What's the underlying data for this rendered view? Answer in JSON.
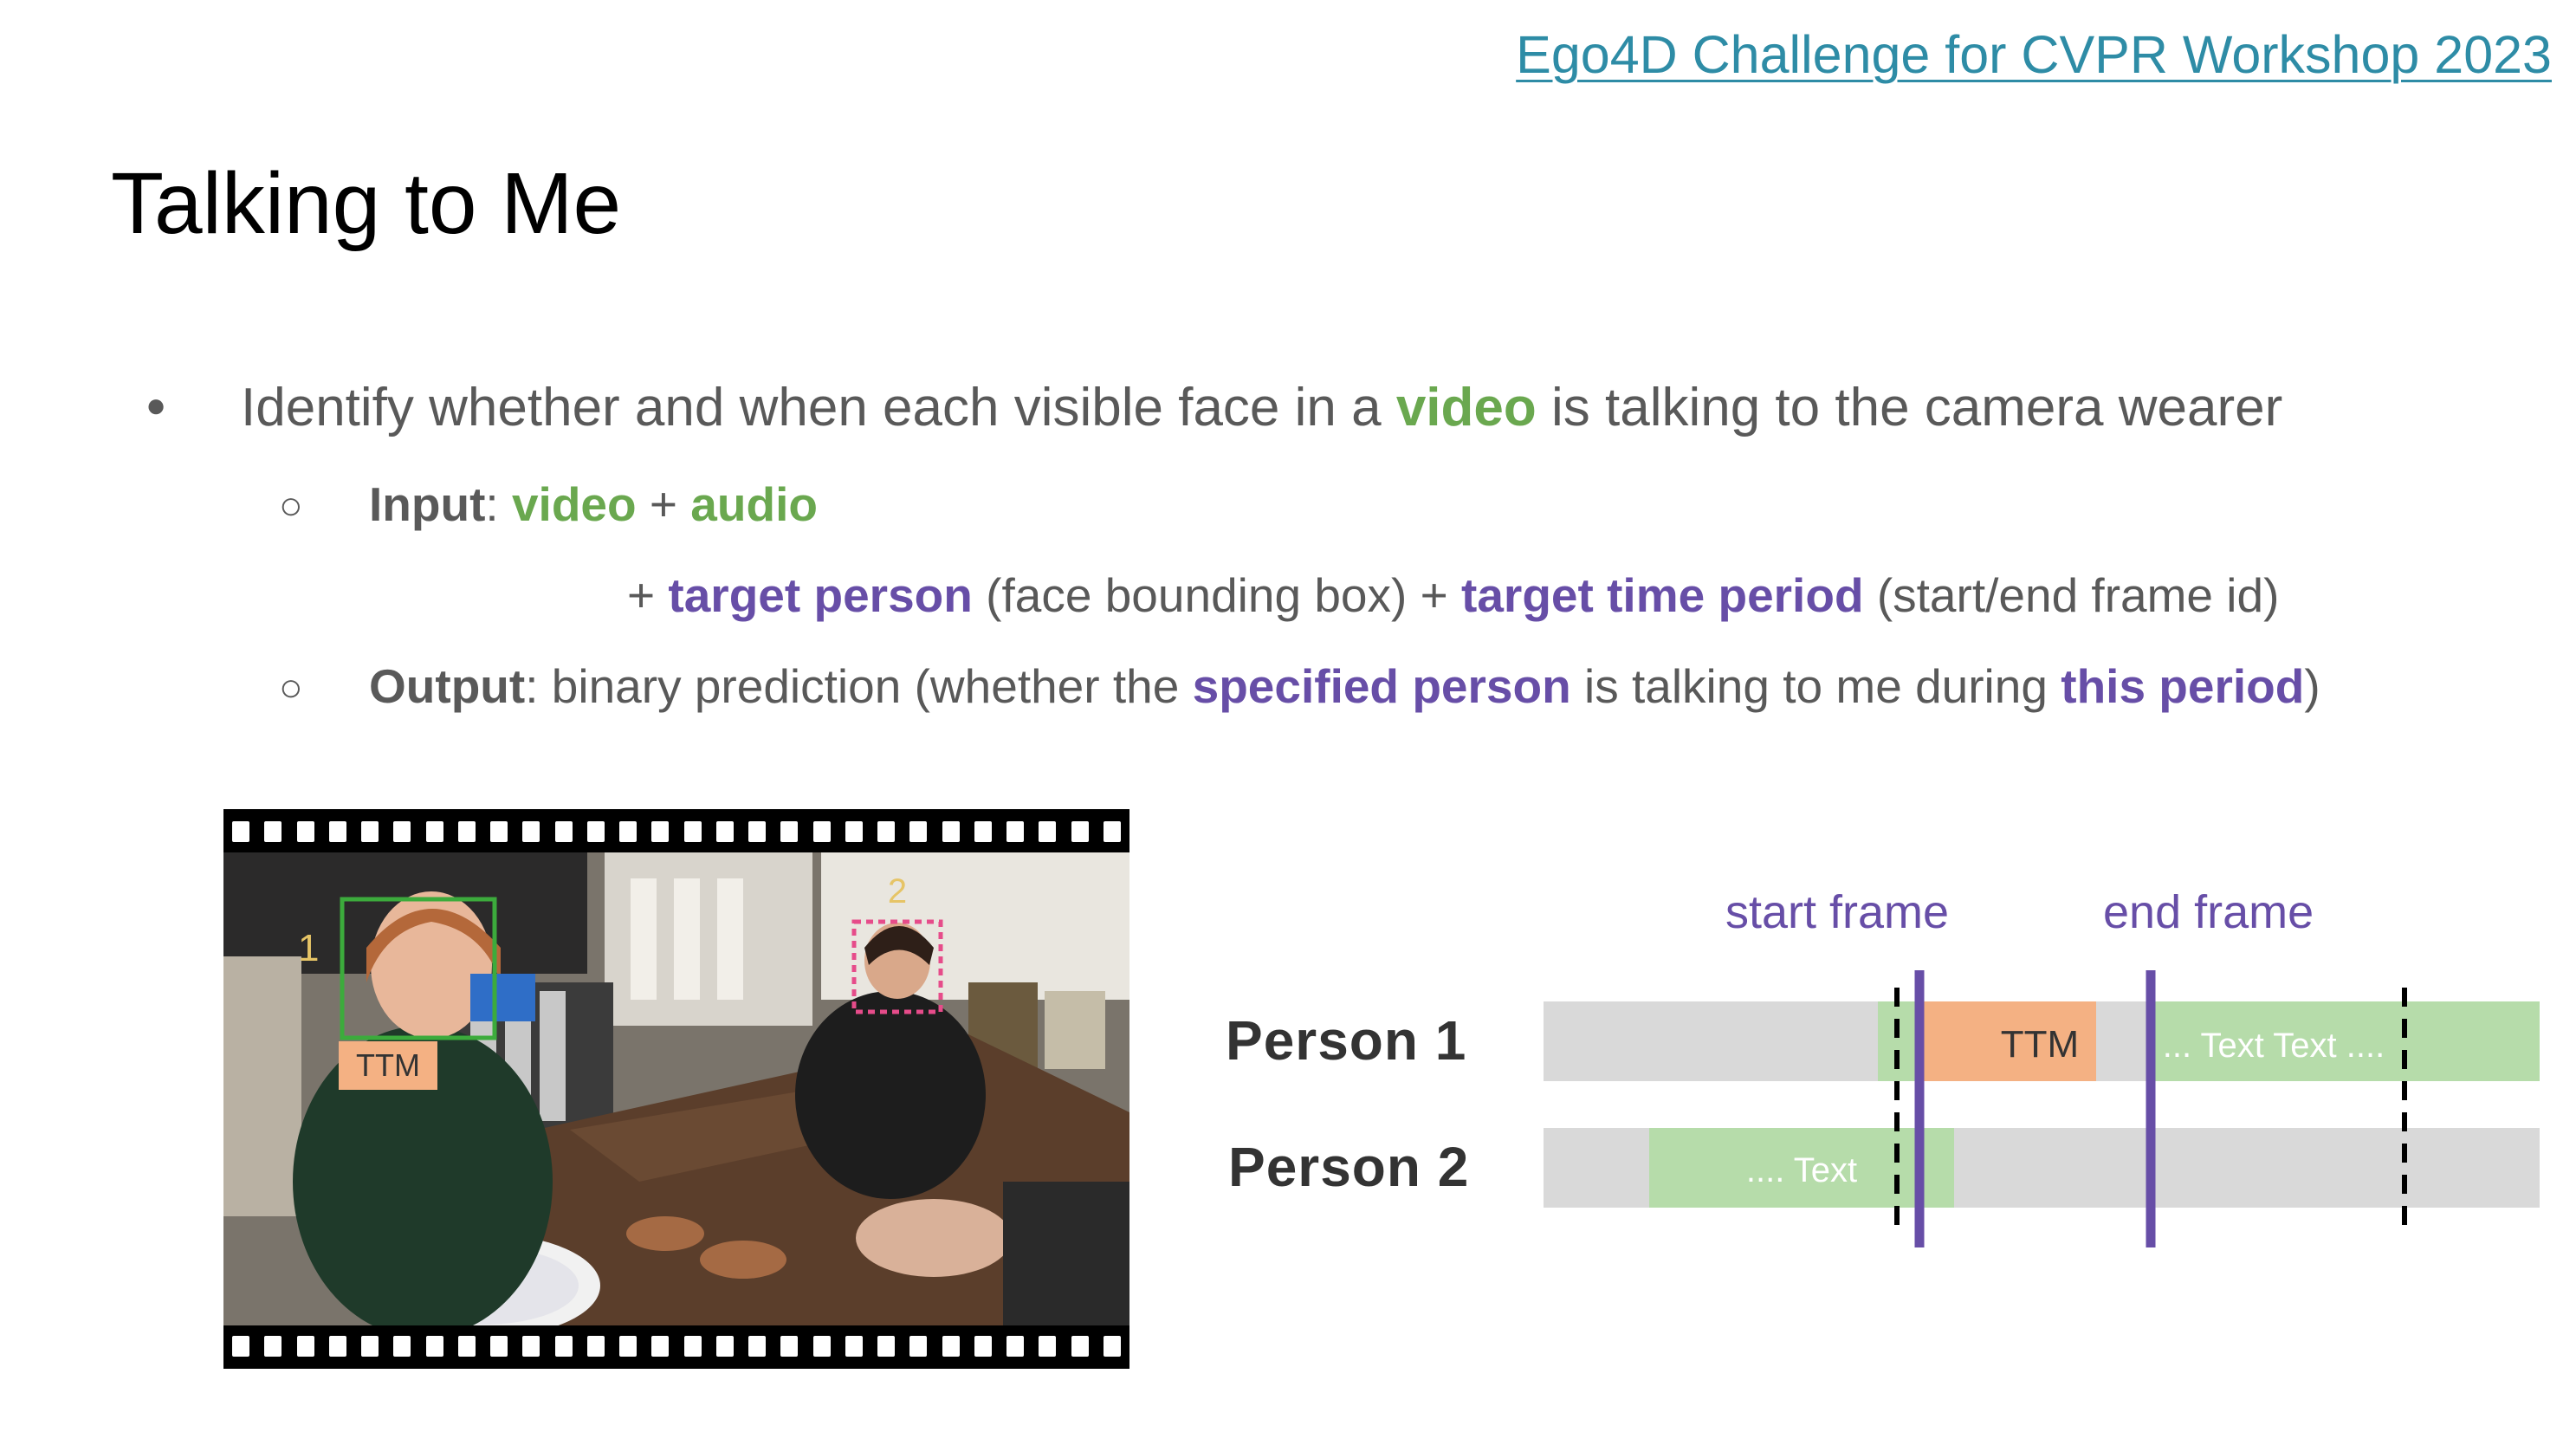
{
  "header": {
    "link_text": "Ego4D Challenge for CVPR Workshop 2023"
  },
  "title": "Talking to Me",
  "bullets": {
    "main": {
      "t1": "Identify whether and when each visible face in a ",
      "t2": "video",
      "t3": " is talking to the camera wearer"
    },
    "input": {
      "label": "Input",
      "sep": ": ",
      "video": "video",
      "plus": " + ",
      "audio": "audio"
    },
    "input_cont": {
      "plus1": "+ ",
      "target_person": "target person",
      "paren1": " (face bounding box) + ",
      "target_time": "target time period",
      "paren2": " (start/end frame id)"
    },
    "output": {
      "label": "Output",
      "t1": ": binary prediction (whether the ",
      "specified": "specified person",
      "t2": " is talking to me during ",
      "this_period": "this period",
      "t3": ")"
    }
  },
  "figure": {
    "face1_number": "1",
    "face2_number": "2",
    "ttm_badge": "TTM"
  },
  "timeline": {
    "start_label": "start frame",
    "end_label": "end frame",
    "rows": [
      {
        "name": "Person 1",
        "ttm": "TTM",
        "text": "... Text Text ...."
      },
      {
        "name": "Person 2",
        "text": ".... Text"
      }
    ],
    "colors": {
      "grey": "#d9d9d9",
      "green": "#b6dcaa",
      "orange": "#f4b183",
      "purple": "#674ea7"
    }
  }
}
